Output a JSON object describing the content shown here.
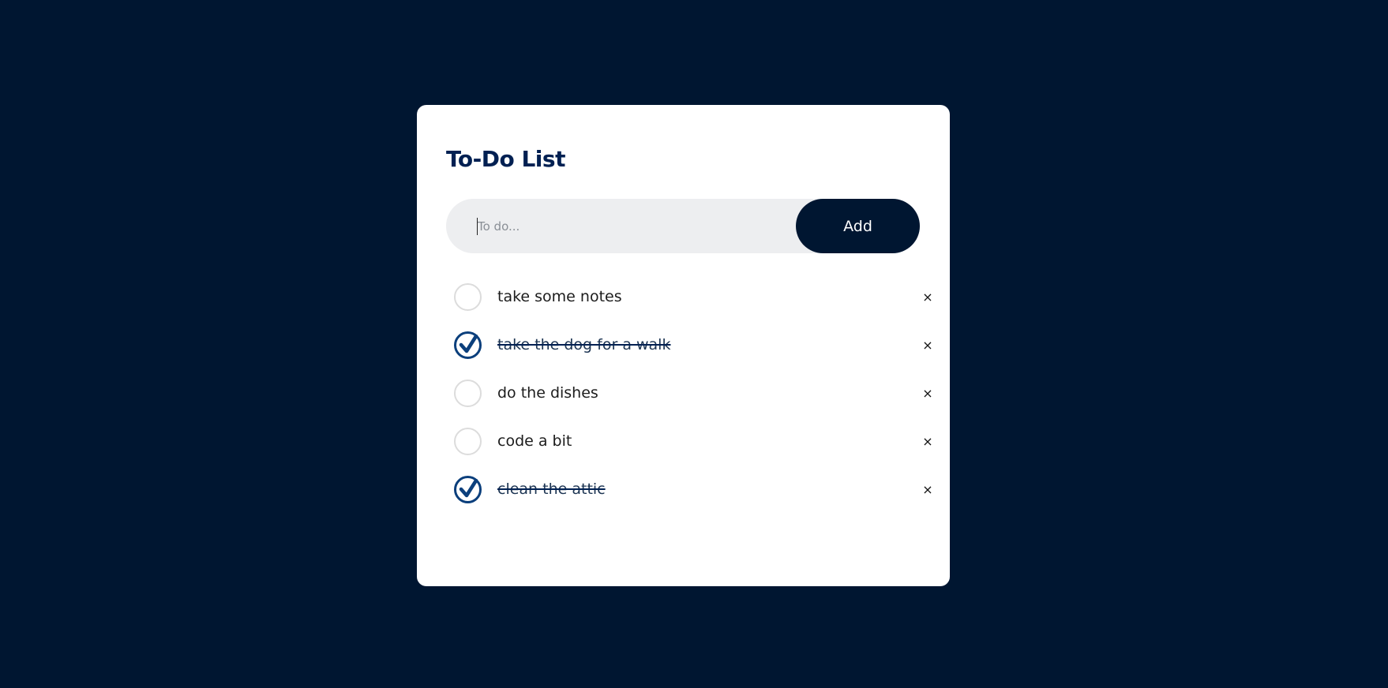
{
  "app": {
    "title": "To-Do List"
  },
  "input": {
    "placeholder": "To do...",
    "value": "",
    "add_label": "Add"
  },
  "todos": [
    {
      "text": "take some notes",
      "done": false,
      "delete_label": "×"
    },
    {
      "text": "take the dog for a walk",
      "done": true,
      "delete_label": "×"
    },
    {
      "text": "do the dishes",
      "done": false,
      "delete_label": "×"
    },
    {
      "text": "code a bit",
      "done": false,
      "delete_label": "×"
    },
    {
      "text": "clean the attic",
      "done": true,
      "delete_label": "×"
    }
  ],
  "colors": {
    "background": "#001631",
    "card": "#ffffff",
    "accent": "#0b3f7c",
    "input_bg": "#edeef0"
  }
}
